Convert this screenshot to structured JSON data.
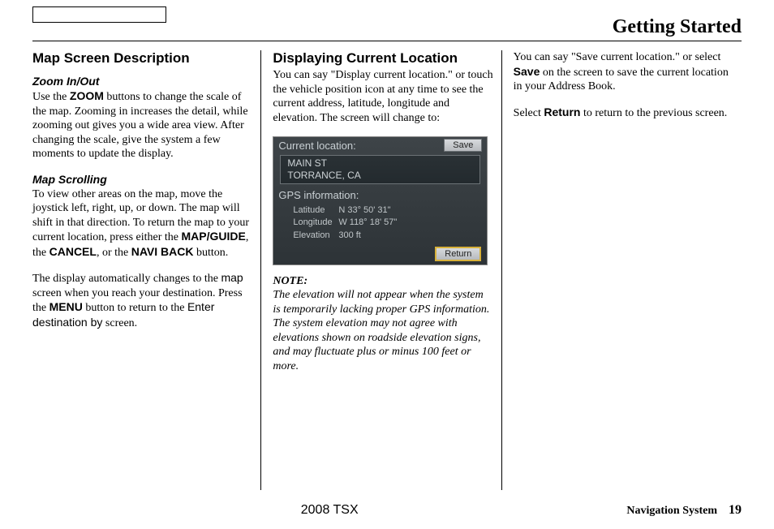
{
  "header": {
    "title": "Getting Started"
  },
  "col1": {
    "h": "Map Screen Description",
    "zoom_h": "Zoom In/Out",
    "zoom_p1a": "Use the ",
    "zoom_b1": "ZOOM",
    "zoom_p1b": " buttons to change the scale of the map. Zooming in increases the detail, while zooming out gives you a wide area view. After changing the scale, give the system a few moments to update the display.",
    "scroll_h": "Map Scrolling",
    "scroll_p1a": "To view other areas on the map, move the joystick left, right, up, or down. The map will shift in that direction. To return the map to your current location, press either the ",
    "scroll_b1": "MAP/GUIDE",
    "scroll_p1b": ", the ",
    "scroll_b2": "CANCEL",
    "scroll_p1c": ", or the ",
    "scroll_b3": "NAVI BACK",
    "scroll_p1d": " button.",
    "scroll_p2a": "The display automatically changes to the ",
    "scroll_sans1": "map",
    "scroll_p2b": " screen when you reach your destination. Press the ",
    "scroll_b4": "MENU",
    "scroll_p2c": " button to return to the ",
    "scroll_sans2": "Enter destination by",
    "scroll_p2d": " screen."
  },
  "col2": {
    "h": "Displaying Current Location",
    "p1": "You can say \"Display current location.\" or touch the vehicle position icon at any time to see the current address, latitude, longitude and elevation. The screen will change to:",
    "note_h": "NOTE:",
    "note_body": "The elevation will not appear when the system is temporarily lacking proper GPS information. The system elevation may not agree with elevations shown on roadside elevation signs, and may fluctuate plus or minus 100 feet or more."
  },
  "screenshot": {
    "title": "Current location:",
    "save": "Save",
    "addr1": "MAIN ST",
    "addr2": "TORRANCE, CA",
    "gps": "GPS information:",
    "lat_k": "Latitude",
    "lat_v": "N 33° 50' 31\"",
    "lon_k": "Longitude",
    "lon_v": "W 118° 18' 57\"",
    "ele_k": "Elevation",
    "ele_v": "300 ft",
    "return": "Return"
  },
  "col3": {
    "p1a": "You can say \"Save current location.\" or select ",
    "p1b": "Save",
    "p1c": " on the screen to save the current location in your Address Book.",
    "p2a": "Select ",
    "p2b": "Return",
    "p2c": " to return to the previous screen."
  },
  "footer": {
    "model": "2008 TSX",
    "sys": "Navigation System",
    "page": "19"
  }
}
